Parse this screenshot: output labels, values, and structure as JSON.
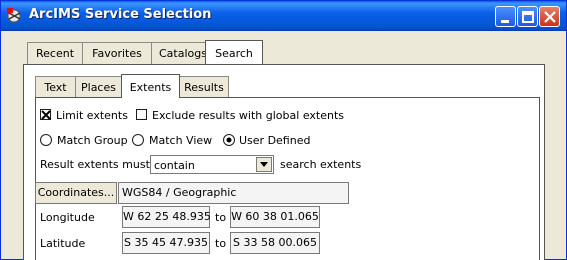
{
  "window": {
    "title": "ArcIMS Service Selection",
    "icons": {
      "app": "arcims-globe-icon",
      "minimize": "minimize-icon",
      "maximize": "maximize-icon",
      "close": "close-icon"
    },
    "colors": {
      "titlebar": "#0553d6",
      "close_button": "#c8331c",
      "panel": "#ece9d8"
    }
  },
  "outer_tabs": [
    {
      "label": "Recent",
      "active": false
    },
    {
      "label": "Favorites",
      "active": false
    },
    {
      "label": "Catalogs",
      "active": false
    },
    {
      "label": "Search",
      "active": true
    }
  ],
  "inner_tabs": [
    {
      "label": "Text",
      "active": false
    },
    {
      "label": "Places",
      "active": false
    },
    {
      "label": "Extents",
      "active": true
    },
    {
      "label": "Results",
      "active": false
    }
  ],
  "extents": {
    "limit_extents": {
      "label": "Limit extents",
      "checked": true
    },
    "exclude_global": {
      "label": "Exclude results with global extents",
      "checked": false
    },
    "match_group": {
      "label": "Match Group",
      "selected": false
    },
    "match_view": {
      "label": "Match View",
      "selected": false
    },
    "user_defined": {
      "label": "User Defined",
      "selected": true
    },
    "result_prefix": "Result extents must",
    "result_mode": "contain",
    "result_suffix": "search extents",
    "coordinates_button": "Coordinates...",
    "coordinate_system": "WGS84 / Geographic",
    "longitude_label": "Longitude",
    "longitude_from": "W 62 25 48.935",
    "longitude_to": "W 60 38 01.065",
    "latitude_label": "Latitude",
    "latitude_from": "S 35 45 47.935",
    "latitude_to": "S 33 58 00.065",
    "to_label": "to"
  }
}
